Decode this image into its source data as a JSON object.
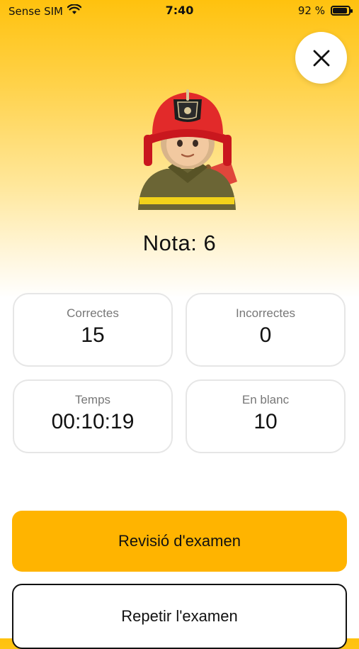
{
  "status_bar": {
    "carrier": "Sense SIM",
    "time": "7:40",
    "battery_percent": "92 %",
    "battery_level": 0.92
  },
  "header": {
    "close_icon": "close-x-icon",
    "avatar_icon": "firefighter-icon"
  },
  "result": {
    "grade_text": "Nota: 6"
  },
  "stats": {
    "correct": {
      "label": "Correctes",
      "value": "15"
    },
    "incorrect": {
      "label": "Incorrectes",
      "value": "0"
    },
    "time": {
      "label": "Temps",
      "value": "00:10:19"
    },
    "blank": {
      "label": "En blanc",
      "value": "10"
    }
  },
  "actions": {
    "review_label": "Revisió d'examen",
    "repeat_label": "Repetir l'examen"
  },
  "colors": {
    "accent": "#ffb400",
    "header_gradient_top": "#ffc20e",
    "card_border": "#e6e6e6"
  }
}
